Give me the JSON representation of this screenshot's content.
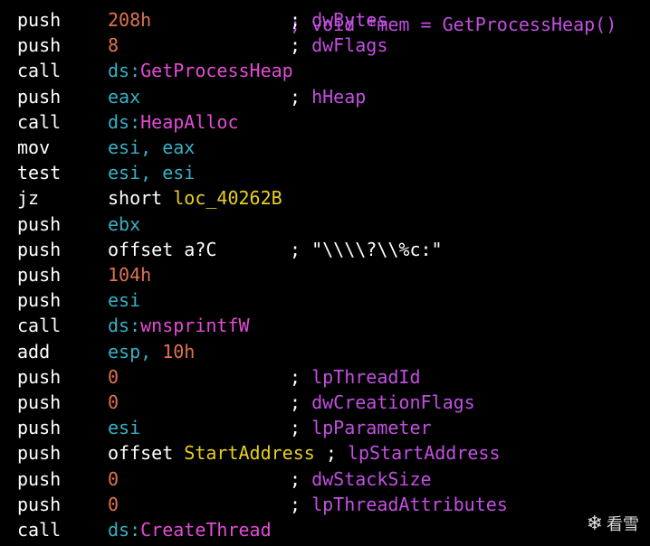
{
  "top_partial": {
    "comment": "; void *mem = GetProcessHeap()"
  },
  "lines": [
    {
      "mnemonic": "push",
      "operand": [
        {
          "t": "208h",
          "c": "num"
        }
      ],
      "comment": [
        {
          "t": "; ",
          "c": "white"
        },
        {
          "t": "dwBytes",
          "c": "com"
        }
      ]
    },
    {
      "mnemonic": "push",
      "operand": [
        {
          "t": "8",
          "c": "num"
        }
      ],
      "comment": [
        {
          "t": "; ",
          "c": "white"
        },
        {
          "t": "dwFlags",
          "c": "com"
        }
      ]
    },
    {
      "mnemonic": "call",
      "operand": [
        {
          "t": "ds:",
          "c": "reg"
        },
        {
          "t": "GetProcessHeap",
          "c": "api"
        }
      ],
      "comment": []
    },
    {
      "mnemonic": "push",
      "operand": [
        {
          "t": "eax",
          "c": "reg"
        }
      ],
      "comment": [
        {
          "t": "; ",
          "c": "white"
        },
        {
          "t": "hHeap",
          "c": "com"
        }
      ]
    },
    {
      "mnemonic": "call",
      "operand": [
        {
          "t": "ds:",
          "c": "reg"
        },
        {
          "t": "HeapAlloc",
          "c": "api"
        }
      ],
      "comment": []
    },
    {
      "mnemonic": "mov",
      "operand": [
        {
          "t": "esi, eax",
          "c": "reg"
        }
      ],
      "comment": []
    },
    {
      "mnemonic": "test",
      "operand": [
        {
          "t": "esi, esi",
          "c": "reg"
        }
      ],
      "comment": []
    },
    {
      "mnemonic": "jz",
      "operand": [
        {
          "t": "short ",
          "c": "white"
        },
        {
          "t": "loc_40262B",
          "c": "sym"
        }
      ],
      "comment": []
    },
    {
      "mnemonic": "push",
      "operand": [
        {
          "t": "ebx",
          "c": "reg"
        }
      ],
      "comment": []
    },
    {
      "mnemonic": "push",
      "operand": [
        {
          "t": "offset a?C",
          "c": "white"
        }
      ],
      "comment": [
        {
          "t": "; \"\\\\\\\\?\\\\%c:\"",
          "c": "white"
        }
      ]
    },
    {
      "mnemonic": "push",
      "operand": [
        {
          "t": "104h",
          "c": "num"
        }
      ],
      "comment": []
    },
    {
      "mnemonic": "push",
      "operand": [
        {
          "t": "esi",
          "c": "reg"
        }
      ],
      "comment": []
    },
    {
      "mnemonic": "call",
      "operand": [
        {
          "t": "ds:",
          "c": "reg"
        },
        {
          "t": "wnsprintfW",
          "c": "api"
        }
      ],
      "comment": []
    },
    {
      "mnemonic": "add",
      "operand": [
        {
          "t": "esp, ",
          "c": "reg"
        },
        {
          "t": "10h",
          "c": "num"
        }
      ],
      "comment": []
    },
    {
      "mnemonic": "push",
      "operand": [
        {
          "t": "0",
          "c": "num"
        }
      ],
      "comment": [
        {
          "t": "; ",
          "c": "white"
        },
        {
          "t": "lpThreadId",
          "c": "com"
        }
      ]
    },
    {
      "mnemonic": "push",
      "operand": [
        {
          "t": "0",
          "c": "num"
        }
      ],
      "comment": [
        {
          "t": "; ",
          "c": "white"
        },
        {
          "t": "dwCreationFlags",
          "c": "com"
        }
      ]
    },
    {
      "mnemonic": "push",
      "operand": [
        {
          "t": "esi",
          "c": "reg"
        }
      ],
      "comment": [
        {
          "t": "; ",
          "c": "white"
        },
        {
          "t": "lpParameter",
          "c": "com"
        }
      ]
    },
    {
      "mnemonic": "push",
      "operand": [
        {
          "t": "offset ",
          "c": "white"
        },
        {
          "t": "StartAddress",
          "c": "sym"
        }
      ],
      "comment_after_operand": [
        {
          "t": " ; ",
          "c": "white"
        },
        {
          "t": "lpStartAddress",
          "c": "com"
        }
      ]
    },
    {
      "mnemonic": "push",
      "operand": [
        {
          "t": "0",
          "c": "num"
        }
      ],
      "comment": [
        {
          "t": "; ",
          "c": "white"
        },
        {
          "t": "dwStackSize",
          "c": "com"
        }
      ]
    },
    {
      "mnemonic": "push",
      "operand": [
        {
          "t": "0",
          "c": "num"
        }
      ],
      "comment": [
        {
          "t": "; ",
          "c": "white"
        },
        {
          "t": "lpThreadAttributes",
          "c": "com"
        }
      ]
    },
    {
      "mnemonic": "call",
      "operand": [
        {
          "t": "ds:",
          "c": "reg"
        },
        {
          "t": "CreateThread",
          "c": "api"
        }
      ],
      "comment": []
    }
  ],
  "watermark": {
    "icon": "snowflake-icon",
    "text": "看雪"
  },
  "colors": {
    "background": "#000000",
    "mnemonic": "#ffffff",
    "register": "#38b0c6",
    "number": "#e0734e",
    "api": "#e24cd4",
    "symbol": "#e8d020",
    "comment": "#c250e0"
  }
}
